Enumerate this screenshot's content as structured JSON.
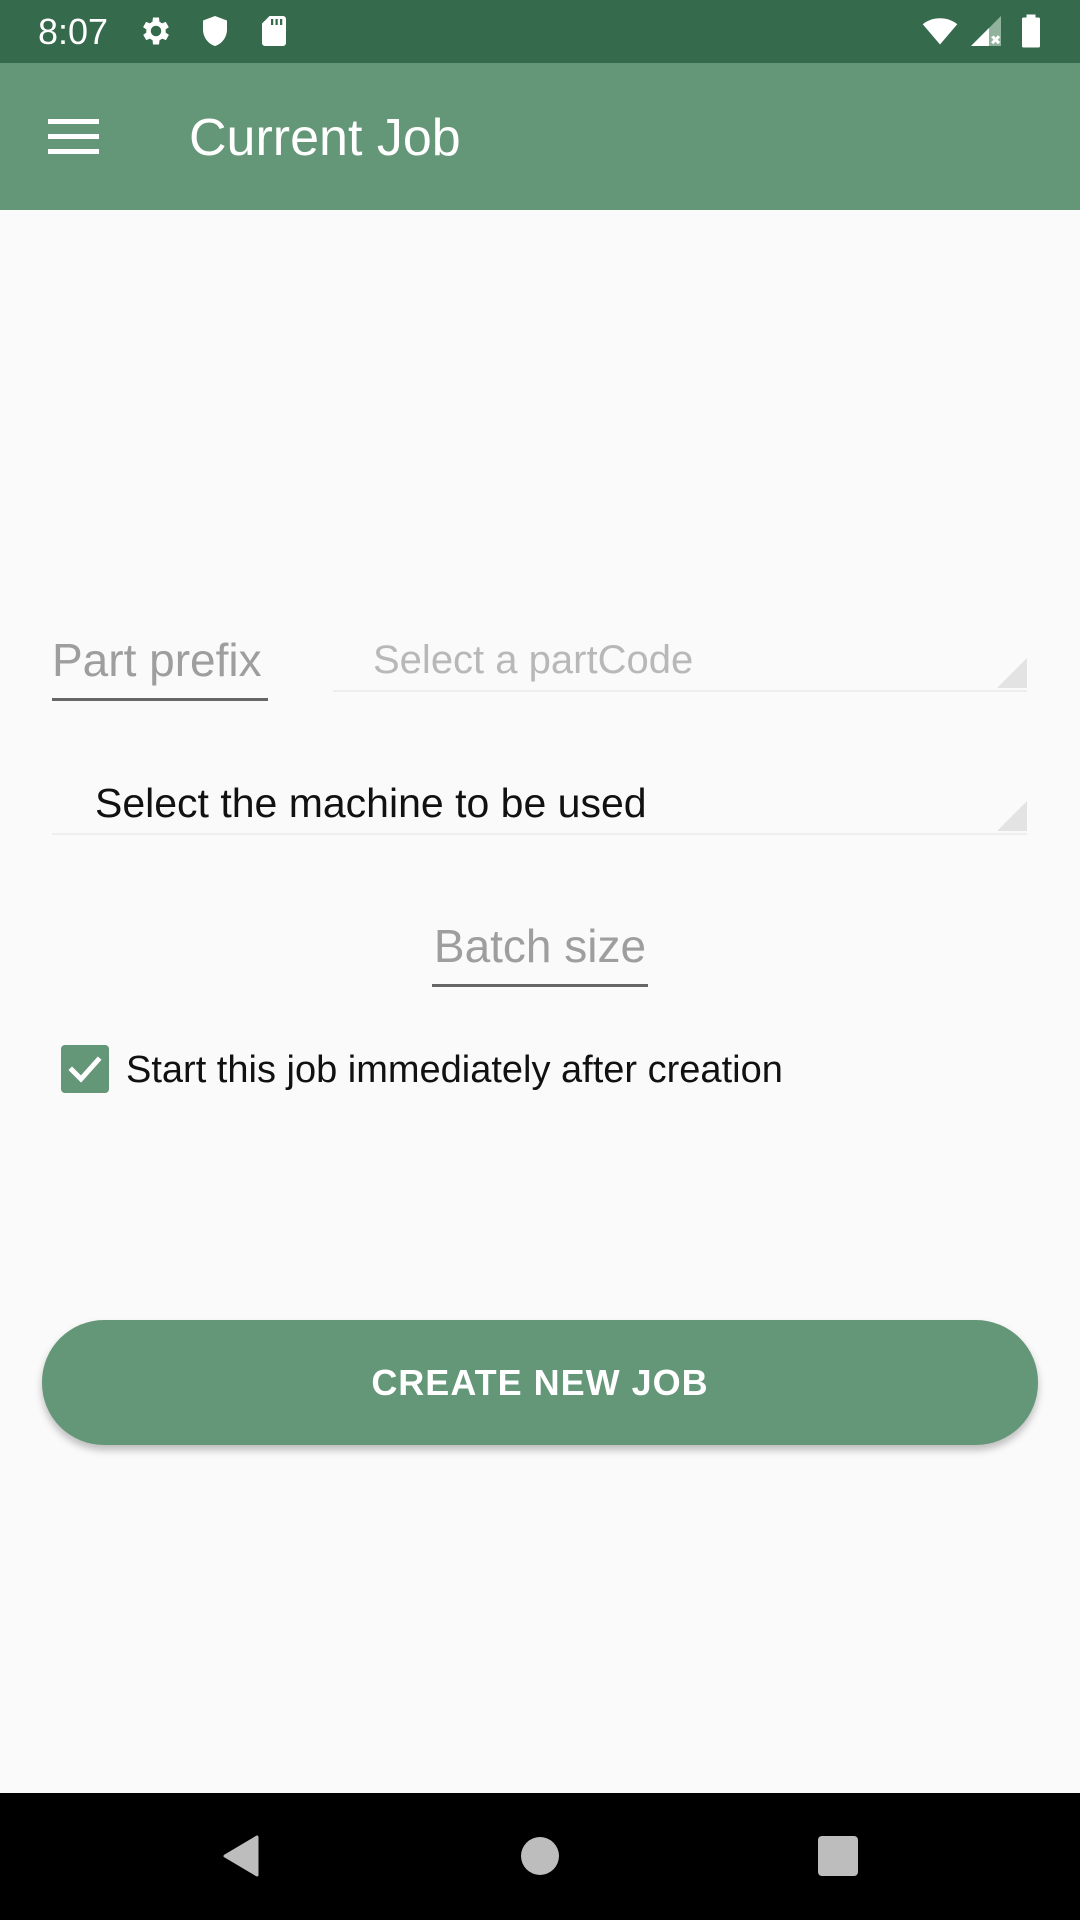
{
  "status_bar": {
    "time": "8:07",
    "left_icons": [
      "gear-icon",
      "shield-icon",
      "sd-card-icon"
    ],
    "right_icons": [
      "wifi-icon",
      "cell-signal-icon",
      "battery-icon"
    ]
  },
  "app_bar": {
    "menu_icon": "hamburger-menu-icon",
    "title": "Current Job"
  },
  "form": {
    "part_prefix_placeholder": "Part prefix",
    "partcode_spinner_label": "Select a partCode",
    "machine_spinner_label": "Select the machine to be used",
    "batch_size_placeholder": "Batch size",
    "start_immediately_label": "Start this job immediately after creation",
    "start_immediately_checked": true
  },
  "actions": {
    "create_button_label": "CREATE NEW JOB"
  },
  "nav_bar": {
    "buttons": [
      "back-icon",
      "home-icon",
      "recents-icon"
    ]
  },
  "colors": {
    "status_bar": "#356a4c",
    "primary": "#649678",
    "background": "#fafafa"
  }
}
